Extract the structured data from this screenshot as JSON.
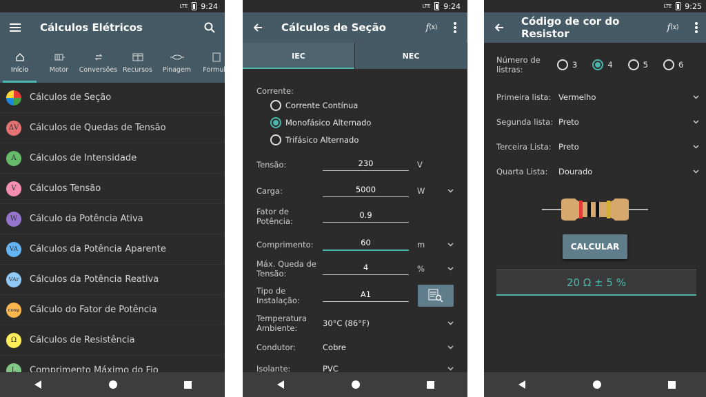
{
  "status": {
    "p1_time": "9:24",
    "p2_time": "9:24",
    "p3_time": "9:25",
    "network": "LTE"
  },
  "panel1": {
    "title": "Cálculos Elétricos",
    "tabs": [
      {
        "label": "Início",
        "icon": "home-icon"
      },
      {
        "label": "Motor",
        "icon": "motor-icon"
      },
      {
        "label": "Conversões",
        "icon": "convert-icon"
      },
      {
        "label": "Recursos",
        "icon": "resources-icon"
      },
      {
        "label": "Pinagem",
        "icon": "pinout-icon"
      },
      {
        "label": "Formulá",
        "icon": "formula-icon"
      }
    ],
    "items": [
      {
        "label": "Cálculos de Seção",
        "badge": "",
        "color": "#ffffff"
      },
      {
        "label": "Cálculos de Quedas de Tensão",
        "badge": "ΔV",
        "color": "#e57373"
      },
      {
        "label": "Cálculos de Intensidade",
        "badge": "A",
        "color": "#66bb6a"
      },
      {
        "label": "Cálculos Tensão",
        "badge": "V",
        "color": "#f48fb1"
      },
      {
        "label": "Cálculo da Potência Ativa",
        "badge": "W",
        "color": "#9575cd"
      },
      {
        "label": "Cálculos da Potência Aparente",
        "badge": "VA",
        "color": "#64b5f6"
      },
      {
        "label": "Cálculos da Potência Reativa",
        "badge": "VAr",
        "color": "#90caf9"
      },
      {
        "label": "Cálculo do Fator de Potência",
        "badge": "cosφ",
        "color": "#ffb74d"
      },
      {
        "label": "Cálculos de Resistência",
        "badge": "Ω",
        "color": "#ffee58"
      },
      {
        "label": "Comprimento Máximo do Fio",
        "badge": "L",
        "color": "#81c784"
      }
    ]
  },
  "panel2": {
    "title": "Cálculos de Seção",
    "fx": "f(x)",
    "tabs": [
      "IEC",
      "NEC"
    ],
    "corrente_label": "Corrente:",
    "radios": [
      "Corrente Contínua",
      "Monofásico Alternado",
      "Trifásico Alternado"
    ],
    "tensao": {
      "label": "Tensão:",
      "value": "230",
      "unit": "V"
    },
    "carga": {
      "label": "Carga:",
      "value": "5000",
      "unit": "W"
    },
    "fator": {
      "label": "Fator de Potência:",
      "value": "0.9"
    },
    "comprimento": {
      "label": "Comprimento:",
      "value": "60",
      "unit": "m"
    },
    "queda": {
      "label": "Máx. Queda de Tensão:",
      "value": "4",
      "unit": "%"
    },
    "tipo": {
      "label": "Tipo de Instalação:",
      "value": "A1"
    },
    "temp": {
      "label": "Temperatura Ambiente:",
      "value": "30°C (86°F)"
    },
    "condutor": {
      "label": "Condutor:",
      "value": "Cobre"
    },
    "isolante": {
      "label": "Isolante:",
      "value": "PVC"
    }
  },
  "panel3": {
    "title": "Código de cor do Resistor",
    "fx": "f(x)",
    "num_label": "Número de listras:",
    "options": [
      "3",
      "4",
      "5",
      "6"
    ],
    "rows": [
      {
        "label": "Primeira lista:",
        "value": "Vermelho"
      },
      {
        "label": "Segunda lista:",
        "value": "Preto"
      },
      {
        "label": "Terceira Lista:",
        "value": "Preto"
      },
      {
        "label": "Quarta Lista:",
        "value": "Dourado"
      }
    ],
    "button": "CALCULAR",
    "result": "20 Ω ± 5 %",
    "band_colors": [
      "#e53935",
      "#111111",
      "#111111",
      "#d4af37"
    ]
  },
  "colors": {
    "accent": "#4db6ac",
    "appbar": "#455a64",
    "bg": "#2b2b2b"
  }
}
